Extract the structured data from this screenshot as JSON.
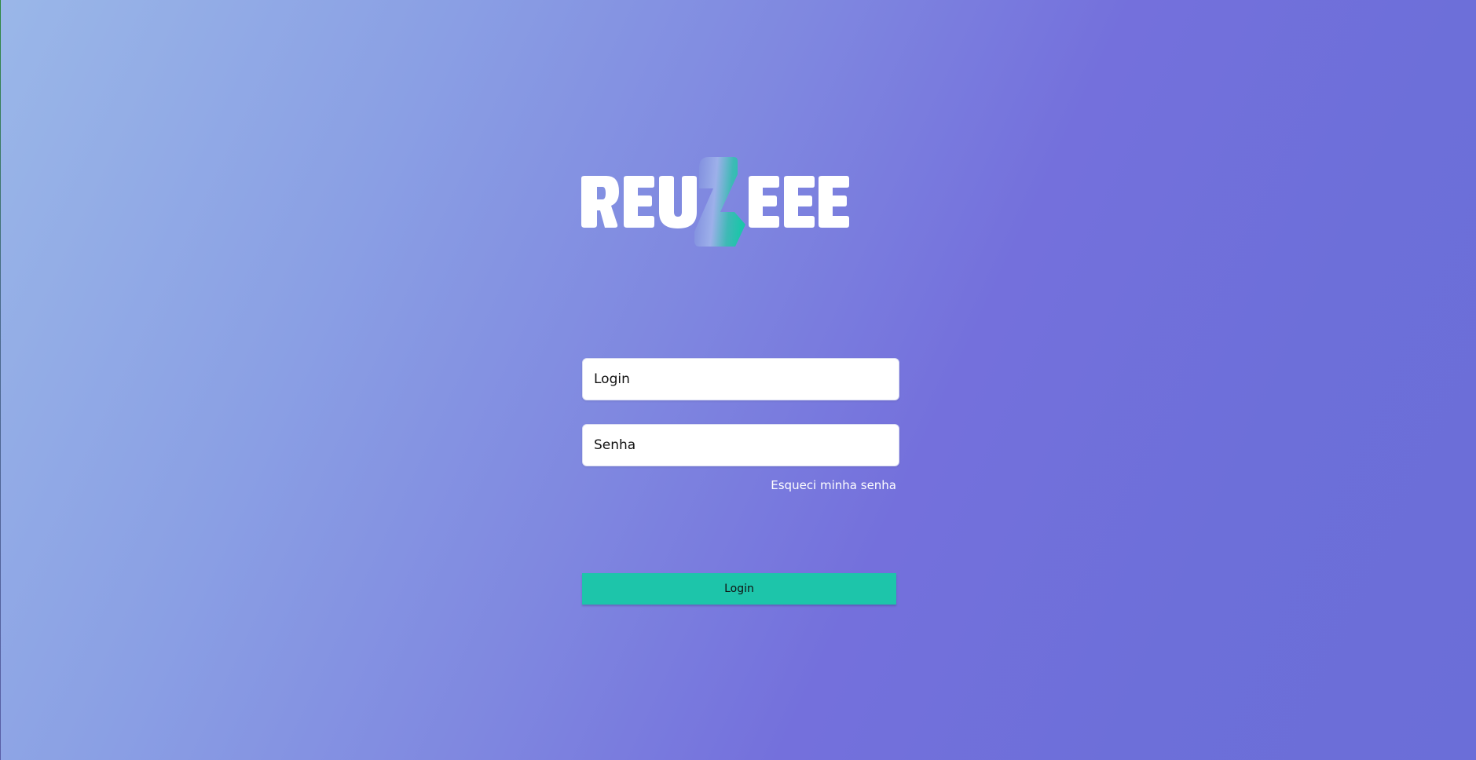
{
  "brand": {
    "logo_text": "REUZEE",
    "accent": "#1dc5aa",
    "background_from": "#9ab7e8",
    "background_to": "#6b6ed8"
  },
  "form": {
    "login_placeholder": "Login",
    "login_value": "",
    "password_placeholder": "Senha",
    "password_value": "",
    "forgot_label": "Esqueci minha senha",
    "submit_label": "Login"
  }
}
